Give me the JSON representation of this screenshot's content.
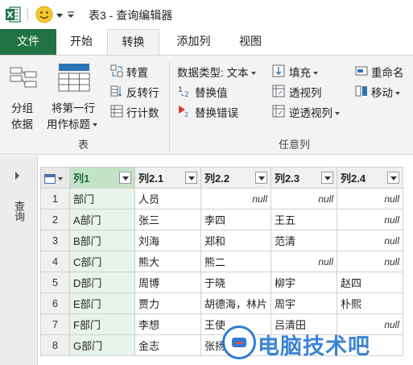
{
  "window": {
    "title": "表3 - 查询编辑器"
  },
  "tabs": [
    {
      "label": "文件"
    },
    {
      "label": "开始"
    },
    {
      "label": "转换"
    },
    {
      "label": "添加列"
    },
    {
      "label": "视图"
    }
  ],
  "ribbon": {
    "table_group": {
      "label": "表",
      "group_by": [
        "分组",
        "依据"
      ],
      "use_first_row": [
        "将第一行",
        "用作标题"
      ],
      "transpose": "转置",
      "reverse_rows": "反转行",
      "count_rows": "行计数"
    },
    "any_column_group": {
      "label": "任意列",
      "data_type": "数据类型: 文本",
      "replace_values": "替换值",
      "replace_errors": "替换错误",
      "fill": "填充",
      "pivot": "透视列",
      "unpivot": "逆透视列",
      "rename": "重命名",
      "move": "移动"
    }
  },
  "nav": {
    "label": "查询"
  },
  "table": {
    "headers": [
      "列1",
      "列2.1",
      "列2.2",
      "列2.3",
      "列2.4"
    ],
    "rows": [
      [
        "1",
        "部门",
        "人员",
        "null",
        "null",
        "null"
      ],
      [
        "2",
        "A部门",
        "张三",
        "李四",
        "王五",
        "null"
      ],
      [
        "3",
        "B部门",
        "刘海",
        "郑和",
        "范清",
        "null"
      ],
      [
        "4",
        "C部门",
        "熊大",
        "熊二",
        "null",
        "null"
      ],
      [
        "5",
        "D部门",
        "周博",
        "于晓",
        "柳宇",
        "赵四"
      ],
      [
        "6",
        "E部门",
        "贾力",
        "胡德海，林片",
        "周宇",
        "朴熙"
      ],
      [
        "7",
        "F部门",
        "李想",
        "王使",
        "吕清田",
        "null"
      ],
      [
        "8",
        "G部门",
        "金志",
        "张扬",
        "",
        ""
      ]
    ]
  },
  "watermark": {
    "text": "电脑技术吧"
  },
  "colors": {
    "excel_green": "#217346",
    "selected_header": "#c3e3c9",
    "watermark_blue": "#1a6fd0"
  }
}
